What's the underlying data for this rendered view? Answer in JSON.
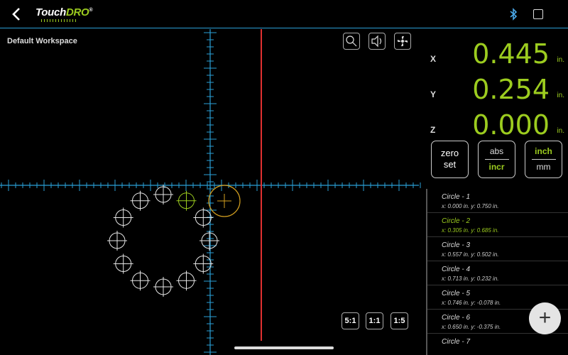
{
  "app": {
    "logo_main": "Touch",
    "logo_accent": "DRO",
    "logo_mark": "®"
  },
  "header": {
    "back_icon": "arrow-back-icon",
    "bluetooth_icon": "bluetooth-icon",
    "fullscreen_icon": "fullscreen-icon"
  },
  "workspace": {
    "title": "Default Workspace"
  },
  "toolbar": {
    "icons": [
      "touch-probe-icon",
      "sound-settings-icon",
      "fan-settings-icon"
    ]
  },
  "zoom": {
    "buttons": [
      "5:1",
      "1:1",
      "1:5"
    ]
  },
  "axes": [
    {
      "label": "X",
      "value": "0.445",
      "unit": "in."
    },
    {
      "label": "Y",
      "value": "0.254",
      "unit": "in."
    },
    {
      "label": "Z",
      "value": "0.000",
      "unit": "in."
    }
  ],
  "controls": {
    "zero_set": {
      "line1": "zero",
      "line2": "set"
    },
    "abs_incr": {
      "top": "abs",
      "bottom": "incr",
      "active": "incr"
    },
    "inch_mm": {
      "top": "inch",
      "bottom": "mm",
      "active": "inch"
    }
  },
  "points_list": {
    "selected_index": 1,
    "items": [
      {
        "name": "Circle - 1",
        "coords": "x: 0.000 in. y: 0.750 in."
      },
      {
        "name": "Circle - 2",
        "coords": "x: 0.305 in. y: 0.685 in."
      },
      {
        "name": "Circle - 3",
        "coords": "x: 0.557 in. y: 0.502 in."
      },
      {
        "name": "Circle - 4",
        "coords": "x: 0.713 in. y: 0.232 in."
      },
      {
        "name": "Circle - 5",
        "coords": "x: 0.746 in. y: -0.078 in."
      },
      {
        "name": "Circle - 6",
        "coords": "x: 0.650 in. y: -0.375 in."
      },
      {
        "name": "Circle - 7",
        "coords": ""
      }
    ]
  },
  "fab": {
    "label": "+",
    "icon": "add-icon"
  },
  "colors": {
    "accent": "#9ccc1f",
    "axis": "#2a9fd6",
    "tool_line": "#e03030",
    "target": "#d4a020"
  }
}
